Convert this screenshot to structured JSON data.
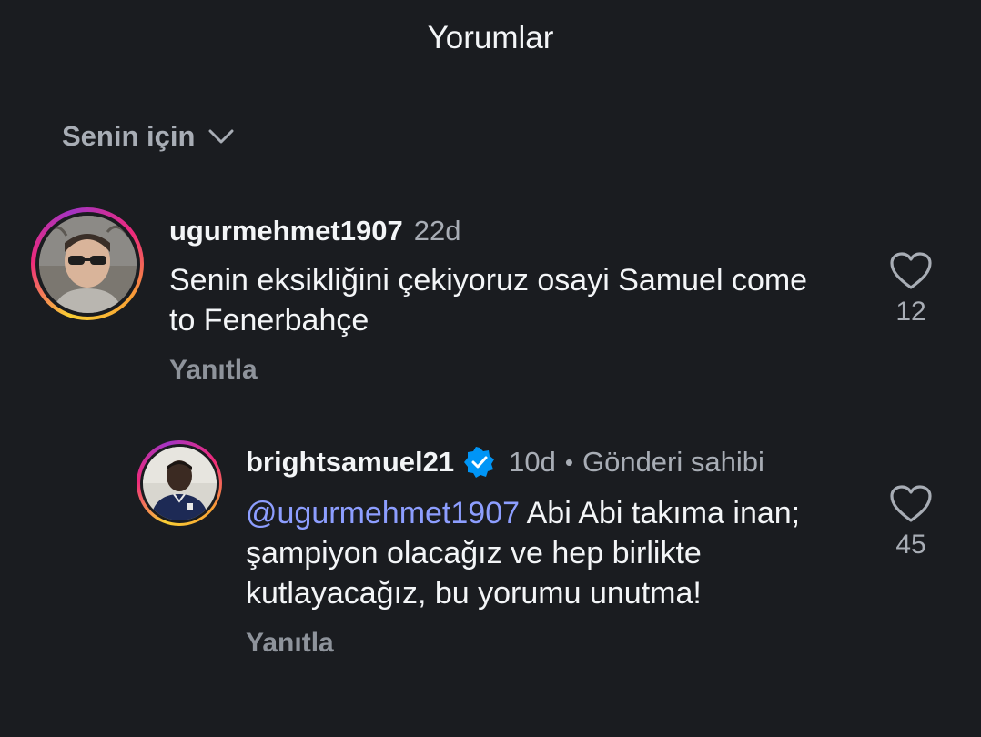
{
  "header": {
    "title": "Yorumlar"
  },
  "sort": {
    "label": "Senin için",
    "icon": "chevron-down-icon"
  },
  "comments": [
    {
      "username": "ugurmehmet1907",
      "time": "22d",
      "text": "Senin eksikliğini çekiyoruz osayi Samuel come to Fenerbahçe",
      "reply_label": "Yanıtla",
      "likes": "12"
    },
    {
      "username": "brightsamuel21",
      "verified": true,
      "time": "10d",
      "separator": "•",
      "owner_label": "Gönderi sahibi",
      "mention": "@ugurmehmet1907",
      "text": "Abi Abi takıma inan; şampiyon olacağız ve hep birlikte kutlayacağız, bu yorumu unutma!",
      "reply_label": "Yanıtla",
      "likes": "45"
    }
  ],
  "colors": {
    "background": "#1a1c20",
    "text": "#f3f5f7",
    "muted": "#a8adb5",
    "mention": "#8d9eff",
    "verified": "#0095f6"
  }
}
